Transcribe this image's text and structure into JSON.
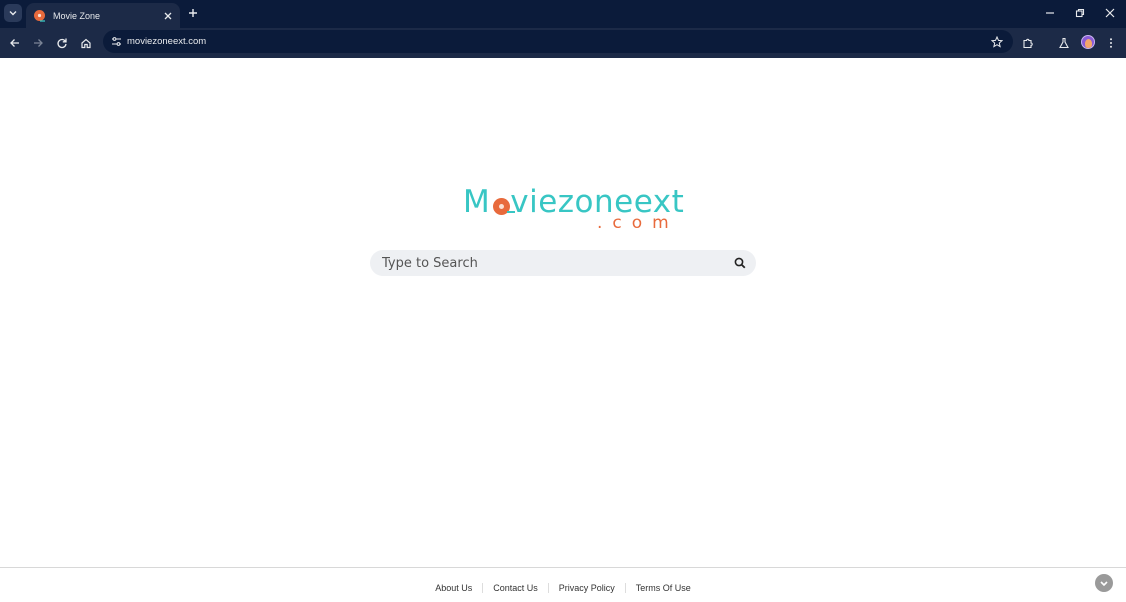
{
  "browser": {
    "tab": {
      "title": "Movie Zone"
    },
    "address_bar": {
      "url": "moviezoneext.com"
    }
  },
  "page": {
    "logo": {
      "main": "Moviezoneext",
      "main_left": "M",
      "main_right": "viezoneext",
      "sub": ".com"
    },
    "search": {
      "placeholder": "Type to Search",
      "value": ""
    },
    "footer": {
      "links": [
        "About Us",
        "Contact Us",
        "Privacy Policy",
        "Terms Of Use"
      ]
    }
  },
  "colors": {
    "brand_teal": "#38c6c4",
    "brand_orange": "#e86a3c",
    "chrome_dark": "#0b1b3a",
    "chrome_mid": "#1c2a47"
  },
  "icons": [
    "tab-list-icon",
    "reel-favicon-icon",
    "close-icon",
    "plus-icon",
    "minimize-icon",
    "restore-icon",
    "back-icon",
    "forward-icon",
    "reload-icon",
    "home-icon",
    "site-info-icon",
    "star-icon",
    "extensions-icon",
    "labs-icon",
    "menu-icon",
    "search-icon"
  ]
}
